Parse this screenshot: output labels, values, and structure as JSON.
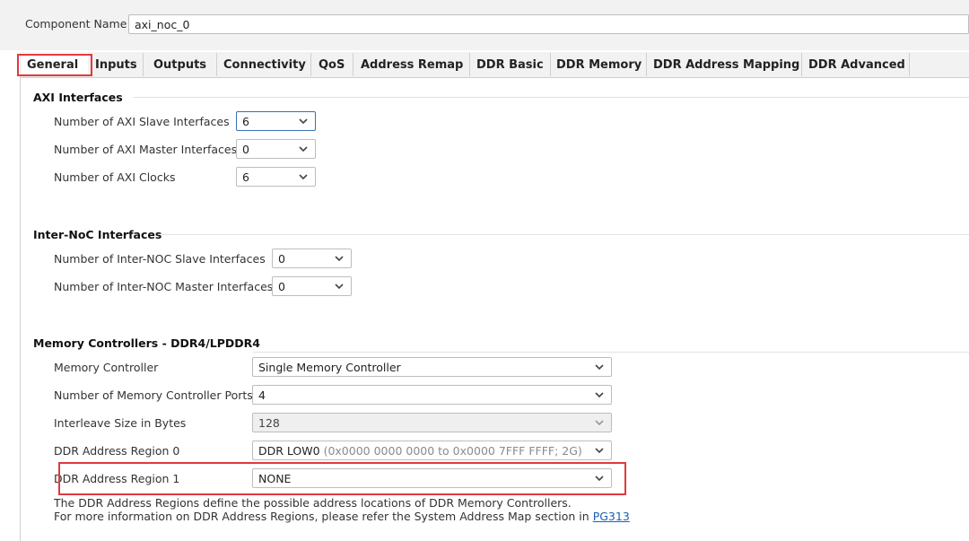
{
  "header": {
    "component_name_label": "Component Name",
    "component_name_value": "axi_noc_0"
  },
  "tabs": [
    {
      "label": "General"
    },
    {
      "label": "Inputs"
    },
    {
      "label": "Outputs"
    },
    {
      "label": "Connectivity"
    },
    {
      "label": "QoS"
    },
    {
      "label": "Address Remap"
    },
    {
      "label": "DDR Basic"
    },
    {
      "label": "DDR Memory"
    },
    {
      "label": "DDR Address Mapping"
    },
    {
      "label": "DDR Advanced"
    }
  ],
  "axi": {
    "title": "AXI Interfaces",
    "slave_label": "Number of AXI Slave Interfaces",
    "slave_value": "6",
    "master_label": "Number of AXI Master Interfaces",
    "master_value": "0",
    "clocks_label": "Number of AXI Clocks",
    "clocks_value": "6"
  },
  "internoc": {
    "title": "Inter-NoC Interfaces",
    "slave_label": "Number of Inter-NOC Slave Interfaces",
    "slave_value": "0",
    "master_label": "Number of Inter-NOC Master Interfaces",
    "master_value": "0"
  },
  "memctrl": {
    "title": "Memory Controllers - DDR4/LPDDR4",
    "controller_label": "Memory Controller",
    "controller_value": "Single Memory Controller",
    "ports_label": "Number of Memory Controller Ports",
    "ports_value": "4",
    "interleave_label": "Interleave Size in Bytes",
    "interleave_value": "128",
    "region0_label": "DDR Address Region 0",
    "region0_value": "DDR LOW0",
    "region0_detail": "(0x0000 0000 0000 to 0x0000 7FFF FFFF; 2G)",
    "region1_label": "DDR Address Region 1",
    "region1_value": "NONE",
    "note_line1": "The DDR Address Regions define the possible address locations of DDR Memory Controllers.",
    "note_line2": "For more information on DDR Address Regions, please refer the System Address Map section in",
    "note_link": "PG313"
  },
  "colors": {
    "highlight": "#e0393e",
    "focus_border": "#3a6fb0",
    "link": "#1a5fb4"
  }
}
